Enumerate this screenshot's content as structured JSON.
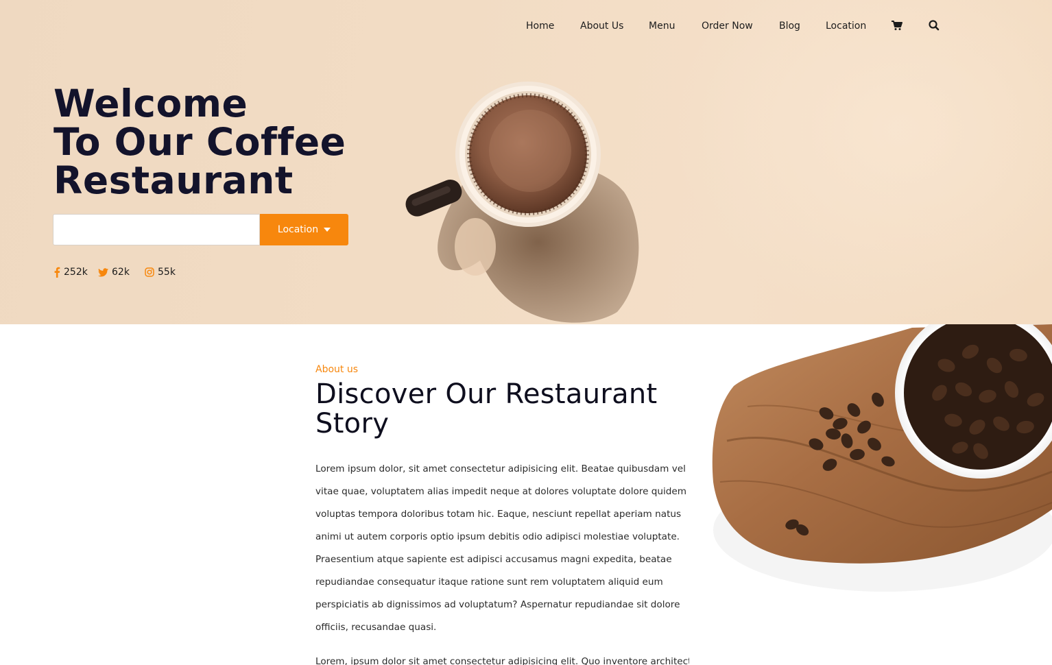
{
  "nav": {
    "items": [
      {
        "label": "Home"
      },
      {
        "label": "About Us"
      },
      {
        "label": "Menu"
      },
      {
        "label": "Order Now"
      },
      {
        "label": "Blog"
      },
      {
        "label": "Location"
      }
    ],
    "cart_icon": "cart-icon",
    "search_icon": "search-icon"
  },
  "hero": {
    "title_lines": [
      "Welcome",
      "To Our Coffee",
      "Restaurant"
    ],
    "search_placeholder": "",
    "location_button": "Location",
    "social": [
      {
        "icon": "facebook-icon",
        "count": "252k"
      },
      {
        "icon": "twitter-icon",
        "count": "62k"
      },
      {
        "icon": "instagram-icon",
        "count": "55k"
      }
    ]
  },
  "about": {
    "kicker": "About us",
    "title_lines": [
      "Discover Our Restaurant",
      "Story"
    ],
    "paragraph": "Lorem ipsum dolor, sit amet consectetur adipisicing elit. Beatae quibusdam vel vitae quae, voluptatem alias impedit neque at dolores voluptate dolore quidem voluptas tempora doloribus totam hic. Eaque, nesciunt repellat aperiam natus animi ut autem corporis optio ipsum debitis odio adipisci molestiae voluptate. Praesentium atque sapiente est adipisci accusamus magni expedita, beatae repudiandae consequatur itaque ratione sunt rem voluptatem aliquid eum perspiciatis ab dignissimos ad voluptatum? Aspernatur repudiandae sit dolore officiis, recusandae quasi.",
    "paragraph2": "Lorem, ipsum dolor sit amet consectetur adipisicing elit. Quo inventore architecto"
  },
  "colors": {
    "accent": "#f7870d",
    "hero_bg": "#f2dcc4",
    "title_text": "#13132b"
  }
}
